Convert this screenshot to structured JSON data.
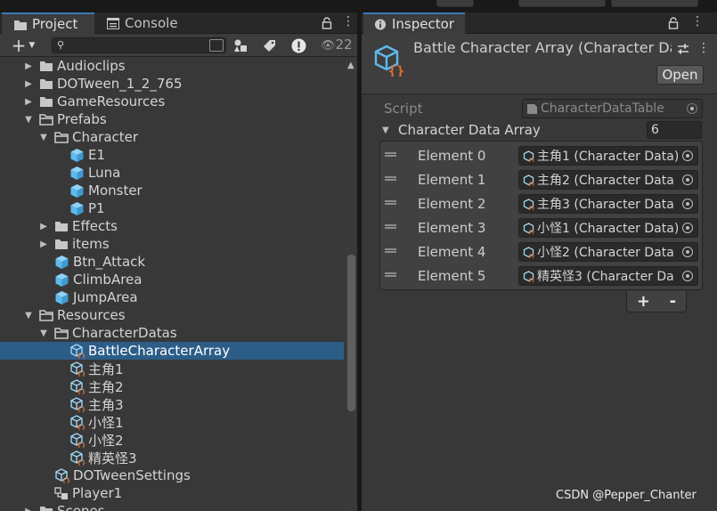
{
  "project": {
    "tabs": [
      "Project",
      "Console"
    ],
    "hidden_count": "22",
    "search": {
      "value": "",
      "placeholder": ""
    },
    "tree": [
      {
        "label": "Audioclips",
        "type": "folder",
        "depth": 1,
        "arrow": "right"
      },
      {
        "label": "DOTween_1_2_765",
        "type": "folder",
        "depth": 1,
        "arrow": "right"
      },
      {
        "label": "GameResources",
        "type": "folder",
        "depth": 1,
        "arrow": "right"
      },
      {
        "label": "Prefabs",
        "type": "folder-open",
        "depth": 1,
        "arrow": "down"
      },
      {
        "label": "Character",
        "type": "folder-open",
        "depth": 2,
        "arrow": "down"
      },
      {
        "label": "E1",
        "type": "prefab",
        "depth": 3,
        "arrow": ""
      },
      {
        "label": "Luna",
        "type": "prefab",
        "depth": 3,
        "arrow": ""
      },
      {
        "label": "Monster",
        "type": "prefab",
        "depth": 3,
        "arrow": ""
      },
      {
        "label": "P1",
        "type": "prefab",
        "depth": 3,
        "arrow": ""
      },
      {
        "label": "Effects",
        "type": "folder",
        "depth": 2,
        "arrow": "right"
      },
      {
        "label": "items",
        "type": "folder",
        "depth": 2,
        "arrow": "right"
      },
      {
        "label": "Btn_Attack",
        "type": "prefab",
        "depth": 2,
        "arrow": ""
      },
      {
        "label": "ClimbArea",
        "type": "prefab",
        "depth": 2,
        "arrow": ""
      },
      {
        "label": "JumpArea",
        "type": "prefab",
        "depth": 2,
        "arrow": ""
      },
      {
        "label": "Resources",
        "type": "folder-open",
        "depth": 1,
        "arrow": "down"
      },
      {
        "label": "CharacterDatas",
        "type": "folder-open",
        "depth": 2,
        "arrow": "down"
      },
      {
        "label": "BattleCharacterArray",
        "type": "so",
        "depth": 3,
        "arrow": "",
        "selected": true
      },
      {
        "label": "主角1",
        "type": "so",
        "depth": 3,
        "arrow": ""
      },
      {
        "label": "主角2",
        "type": "so",
        "depth": 3,
        "arrow": ""
      },
      {
        "label": "主角3",
        "type": "so",
        "depth": 3,
        "arrow": ""
      },
      {
        "label": "小怪1",
        "type": "so",
        "depth": 3,
        "arrow": ""
      },
      {
        "label": "小怪2",
        "type": "so",
        "depth": 3,
        "arrow": ""
      },
      {
        "label": "精英怪3",
        "type": "so",
        "depth": 3,
        "arrow": ""
      },
      {
        "label": "DOTweenSettings",
        "type": "so",
        "depth": 2,
        "arrow": ""
      },
      {
        "label": "Player1",
        "type": "scene",
        "depth": 2,
        "arrow": ""
      },
      {
        "label": "Scenes",
        "type": "folder",
        "depth": 1,
        "arrow": "right"
      }
    ]
  },
  "inspector": {
    "tab": "Inspector",
    "title": "Battle Character Array (Character Dat",
    "open_label": "Open",
    "script_label": "Script",
    "script_value": "CharacterDataTable",
    "array_label": "Character Data Array",
    "array_size": "6",
    "elements": [
      {
        "label": "Element 0",
        "value": "主角1 (Character Data)"
      },
      {
        "label": "Element 1",
        "value": "主角2 (Character Data"
      },
      {
        "label": "Element 2",
        "value": "主角3 (Character Data"
      },
      {
        "label": "Element 3",
        "value": "小怪1 (Character Data)"
      },
      {
        "label": "Element 4",
        "value": "小怪2 (Character Data"
      },
      {
        "label": "Element 5",
        "value": "精英怪3 (Character Da"
      }
    ],
    "add_label": "+",
    "remove_label": "-"
  },
  "watermark": "CSDN @Pepper_Chanter",
  "colors": {
    "selection": "#2c5d87",
    "prefab_icon": "#5fb9ec",
    "so_icon_brace": "#e8702a",
    "panel": "#383838",
    "tab_accent": "#3a79bb"
  }
}
